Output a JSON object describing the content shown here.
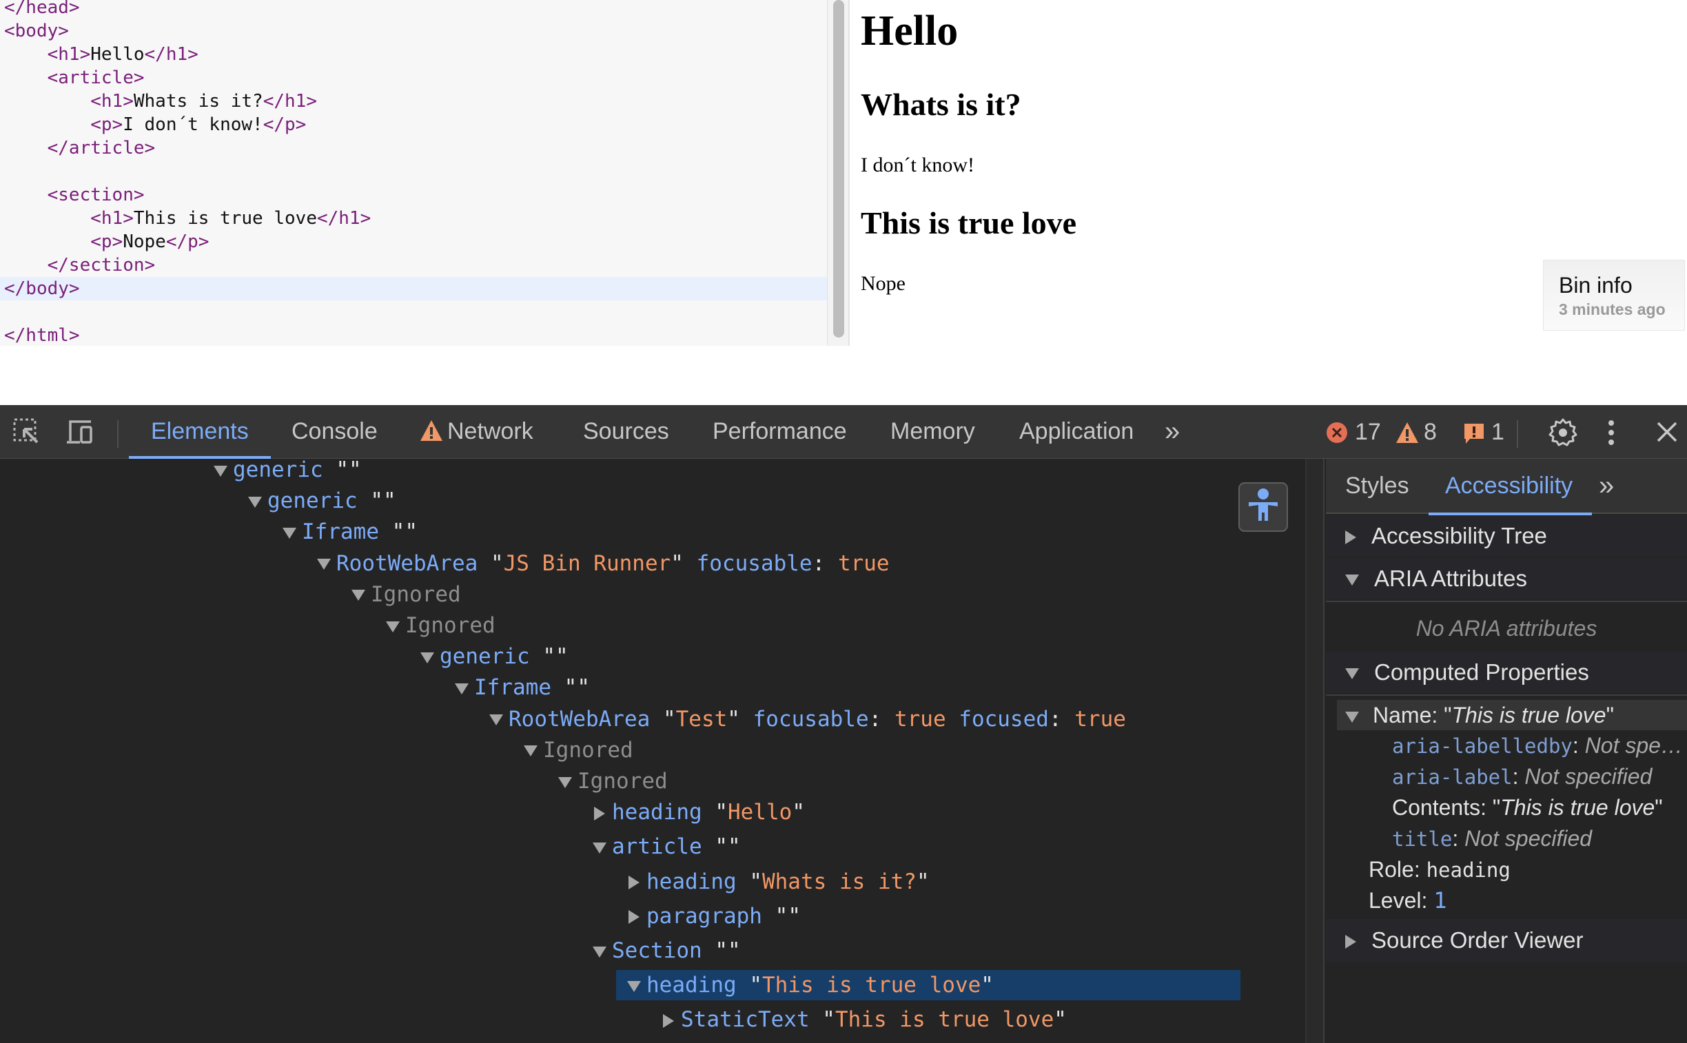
{
  "editor": {
    "lines": [
      {
        "indent": "",
        "parts": [
          {
            "t": "tag",
            "v": "</head>"
          }
        ]
      },
      {
        "indent": "",
        "parts": [
          {
            "t": "tag",
            "v": "<body>"
          }
        ]
      },
      {
        "indent": "    ",
        "parts": [
          {
            "t": "tag",
            "v": "<h1>"
          },
          {
            "t": "txt",
            "v": "Hello"
          },
          {
            "t": "tag",
            "v": "</h1>"
          }
        ]
      },
      {
        "indent": "    ",
        "parts": [
          {
            "t": "tag",
            "v": "<article>"
          }
        ]
      },
      {
        "indent": "        ",
        "parts": [
          {
            "t": "tag",
            "v": "<h1>"
          },
          {
            "t": "txt",
            "v": "Whats is it?"
          },
          {
            "t": "tag",
            "v": "</h1>"
          }
        ]
      },
      {
        "indent": "        ",
        "parts": [
          {
            "t": "tag",
            "v": "<p>"
          },
          {
            "t": "txt",
            "v": "I don´t know!"
          },
          {
            "t": "tag",
            "v": "</p>"
          }
        ]
      },
      {
        "indent": "    ",
        "parts": [
          {
            "t": "tag",
            "v": "</article>"
          }
        ]
      },
      {
        "indent": "",
        "parts": []
      },
      {
        "indent": "    ",
        "parts": [
          {
            "t": "tag",
            "v": "<section>"
          }
        ]
      },
      {
        "indent": "        ",
        "parts": [
          {
            "t": "tag",
            "v": "<h1>"
          },
          {
            "t": "txt",
            "v": "This is true love"
          },
          {
            "t": "tag",
            "v": "</h1>"
          }
        ]
      },
      {
        "indent": "        ",
        "parts": [
          {
            "t": "tag",
            "v": "<p>"
          },
          {
            "t": "txt",
            "v": "Nope"
          },
          {
            "t": "tag",
            "v": "</p>"
          }
        ]
      },
      {
        "indent": "    ",
        "parts": [
          {
            "t": "tag",
            "v": "</section>"
          }
        ]
      },
      {
        "indent": "",
        "parts": [
          {
            "t": "tag",
            "v": "</body>"
          }
        ],
        "active": true
      },
      {
        "indent": "",
        "parts": []
      },
      {
        "indent": "",
        "parts": [
          {
            "t": "tag",
            "v": "</html>"
          }
        ]
      }
    ]
  },
  "preview": {
    "h1": "Hello",
    "article_heading": "Whats is it?",
    "article_paragraph": "I don´t know!",
    "section_heading": "This is true love",
    "section_paragraph": "Nope"
  },
  "bin_info": {
    "title": "Bin info",
    "time": "3 minutes ago"
  },
  "devtools": {
    "toolbar": {
      "tabs": [
        {
          "label": "Elements",
          "active": true
        },
        {
          "label": "Console"
        },
        {
          "label": "Network",
          "warning": true
        },
        {
          "label": "Sources"
        },
        {
          "label": "Performance"
        },
        {
          "label": "Memory"
        },
        {
          "label": "Application"
        }
      ],
      "more_tabs": "»",
      "errors": "17",
      "warnings": "8",
      "issues": "1",
      "colors": {
        "accent": "#7cacf8",
        "error": "#e46f55",
        "warning": "#f29766"
      }
    },
    "tree": [
      {
        "depth": 0,
        "open": true,
        "role": "generic",
        "name": ""
      },
      {
        "depth": 1,
        "open": true,
        "role": "generic",
        "name": ""
      },
      {
        "depth": 2,
        "open": true,
        "role": "Iframe",
        "name": ""
      },
      {
        "depth": 3,
        "open": true,
        "role": "RootWebArea",
        "name": "JS Bin Runner",
        "props": [
          {
            "k": "focusable",
            "v": "true"
          }
        ]
      },
      {
        "depth": 4,
        "open": true,
        "role": "Ignored",
        "ignored": true
      },
      {
        "depth": 5,
        "open": true,
        "role": "Ignored",
        "ignored": true
      },
      {
        "depth": 6,
        "open": true,
        "role": "generic",
        "name": ""
      },
      {
        "depth": 7,
        "open": true,
        "role": "Iframe",
        "name": ""
      },
      {
        "depth": 8,
        "open": true,
        "role": "RootWebArea",
        "name": "Test",
        "props": [
          {
            "k": "focusable",
            "v": "true"
          },
          {
            "k": "focused",
            "v": "true"
          }
        ]
      },
      {
        "depth": 9,
        "open": true,
        "role": "Ignored",
        "ignored": true
      },
      {
        "depth": 10,
        "open": true,
        "role": "Ignored",
        "ignored": true
      },
      {
        "depth": 11,
        "open": false,
        "role": "heading",
        "name": "Hello"
      },
      {
        "depth": 11,
        "open": true,
        "role": "article",
        "name": ""
      },
      {
        "depth": 12,
        "open": false,
        "role": "heading",
        "name": "Whats is it?"
      },
      {
        "depth": 12,
        "open": false,
        "role": "paragraph",
        "name": ""
      },
      {
        "depth": 11,
        "open": true,
        "role": "Section",
        "name": ""
      },
      {
        "depth": 12,
        "open": true,
        "role": "heading",
        "name": "This is true love",
        "selected": true
      },
      {
        "depth": 13,
        "open": false,
        "role": "StaticText",
        "name": "This is true love"
      }
    ],
    "side": {
      "tabs": [
        {
          "label": "Styles"
        },
        {
          "label": "Accessibility",
          "active": true
        }
      ],
      "more_tabs": "»",
      "sections": {
        "tree": "Accessibility Tree",
        "aria": "ARIA Attributes",
        "aria_empty": "No ARIA attributes",
        "computed": "Computed Properties",
        "source_order": "Source Order Viewer"
      },
      "computed": {
        "name_label": "Name: ",
        "name_value": "This is true love",
        "aria_labelledby_key": "aria-labelledby",
        "aria_labelledby_val": "Not spe…",
        "aria_label_key": "aria-label",
        "aria_label_val": "Not specified",
        "contents_label": "Contents: ",
        "contents_value": "This is true love",
        "title_key": "title",
        "title_val": "Not specified",
        "role_label": "Role: ",
        "role_value": "heading",
        "level_label": "Level: ",
        "level_value": "1"
      }
    }
  }
}
